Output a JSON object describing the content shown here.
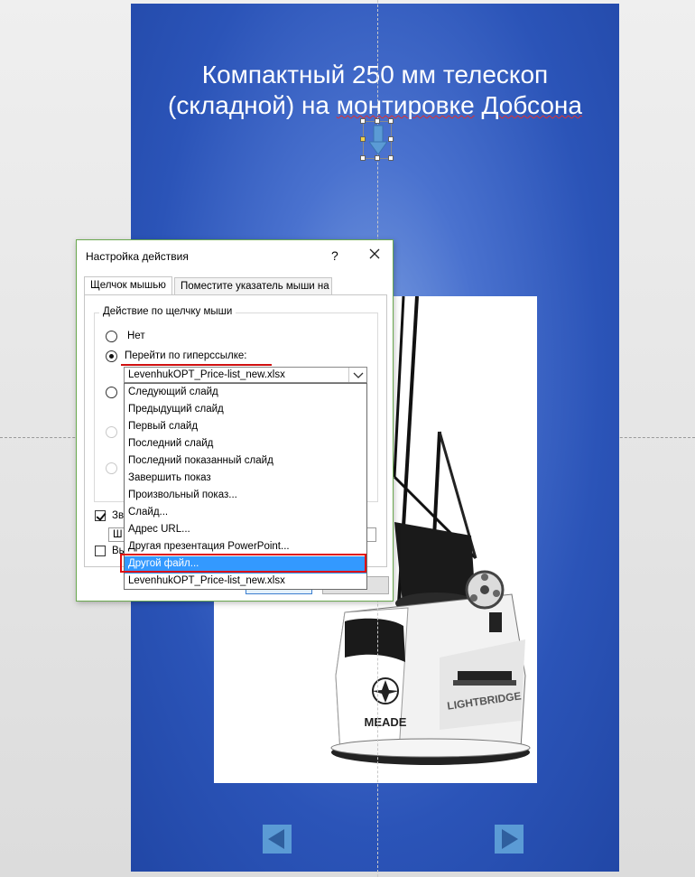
{
  "slide": {
    "title_line1": "Компактный  250 мм телескоп",
    "title_line2_a": "(складной) на ",
    "title_line2_b": "монтировке",
    "title_line2_c": " ",
    "title_line2_d": "Добсона",
    "photo_logo_brand": "MEADE",
    "photo_logo_model": "LIGHTBRIDGE"
  },
  "dialog": {
    "title": "Настройка действия",
    "help": "?",
    "tabs": [
      "Щелчок мышью",
      "Поместите указатель мыши на"
    ],
    "group_label": "Действие по щелчку мыши",
    "radio_none": "Нет",
    "radio_hyperlink": "Перейти по гиперссылке:",
    "hyperlink_value": "LevenhukOPT_Price-list_new.xlsx",
    "dropdown_items": [
      "Следующий слайд",
      "Предыдущий слайд",
      "Первый слайд",
      "Последний слайд",
      "Последний показанный слайд",
      "Завершить показ",
      "Произвольный показ...",
      "Слайд...",
      "Адрес URL...",
      "Другая презентация PowerPoint...",
      "Другой файл...",
      "LevenhukOPT_Price-list_new.xlsx"
    ],
    "selected_index": 10,
    "partial_label_1": "Зв",
    "partial_label_2": "Ш",
    "partial_label_3": "Вь"
  },
  "colors": {
    "slide_blue": "#2b54b8",
    "selection_blue": "#3399ff",
    "annotation_red": "#e01010",
    "dialog_border": "#6aa84f",
    "arrow_blue": "#5b9bd5"
  }
}
